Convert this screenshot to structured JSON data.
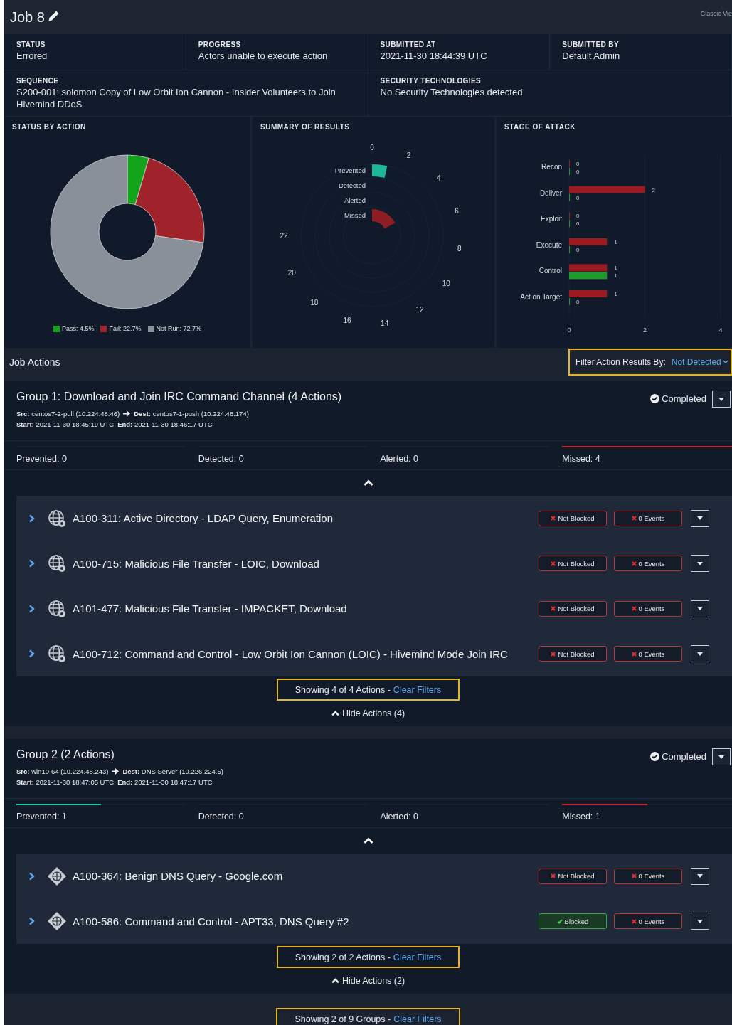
{
  "header": {
    "title": "Job 8",
    "view_link": "Classic Vie"
  },
  "info_rows": [
    [
      {
        "label": "STATUS",
        "value": "Errored"
      },
      {
        "label": "PROGRESS",
        "value": "Actors unable to execute action"
      },
      {
        "label": "SUBMITTED AT",
        "value": "2021-11-30 18:44:39 UTC"
      },
      {
        "label": "SUBMITTED BY",
        "value": "Default Admin"
      }
    ],
    [
      {
        "label": "SEQUENCE",
        "value": "S200-001: solomon Copy of Low Orbit Ion Cannon - Insider Volunteers to Join Hivemind DDoS"
      },
      {
        "label": "SECURITY TECHNOLOGIES",
        "value": "No Security Technologies detected"
      }
    ]
  ],
  "status_by_action": {
    "title": "STATUS BY ACTION",
    "chart_data": {
      "type": "donut",
      "categories": [
        "Pass: 4.5%",
        "Fail: 22.7%",
        "Not Run: 72.7%"
      ],
      "values": [
        4.5,
        22.7,
        72.7
      ],
      "colors": [
        "#14a41c",
        "#a0222a",
        "#8a9099"
      ],
      "legend": "bottom"
    }
  },
  "summary_of_results": {
    "title": "SUMMARY OF RESULTS",
    "scale_labels": [
      "0",
      "2",
      "4",
      "6",
      "8",
      "10",
      "12",
      "14",
      "16",
      "18",
      "20",
      "22"
    ],
    "rings": [
      {
        "label": "Prevented",
        "color": "#1fb597"
      },
      {
        "label": "Detected"
      },
      {
        "label": "Alerted"
      },
      {
        "label": "Missed",
        "color": "#8c1e24"
      }
    ]
  },
  "stage_of_attack": {
    "title": "STAGE OF ATTACK",
    "chart_data": {
      "type": "bar",
      "orientation": "horizontal",
      "categories": [
        "Recon",
        "Deliver",
        "Exploit",
        "Execute",
        "Control",
        "Act on Target"
      ],
      "series": [
        {
          "color": "#9b1b20",
          "values": [
            0,
            2,
            0,
            1,
            1,
            1
          ]
        },
        {
          "color": "#1f9a2a",
          "values": [
            0,
            0,
            0,
            0,
            1,
            0
          ]
        }
      ],
      "xlim": [
        0,
        4
      ],
      "xticks": [
        0,
        2,
        4
      ],
      "data_labels": true
    }
  },
  "job_actions": {
    "title": "Job Actions",
    "filter": {
      "label": "Filter Action Results By:",
      "value": "Not Detected"
    }
  },
  "groups": [
    {
      "title": "Group 1: Download and Join IRC Command Channel (4 Actions)",
      "status": "Completed",
      "src_label": "Src:",
      "src": "centos7-2-pull (10.224.48.46)",
      "dest_label": "Dest:",
      "dest": "centos7-1-push (10.224.48.174)",
      "start_label": "Start:",
      "start": "2021-11-30 18:45:19 UTC",
      "end_label": "End:",
      "end": "2021-11-30 18:46:17 UTC",
      "stats": [
        {
          "label": "Prevented: 0"
        },
        {
          "label": "Detected: 0"
        },
        {
          "label": "Alerted: 0"
        },
        {
          "label": "Missed: 4",
          "level": 1,
          "color": "#c0262b"
        }
      ],
      "actions": [
        {
          "kind": "globe",
          "title": "A100-311: Active Directory - LDAP Query, Enumeration",
          "blocked": false,
          "blocked_label": "Not Blocked",
          "events": "0 Events"
        },
        {
          "kind": "globe",
          "title": "A100-715: Malicious File Transfer - LOIC, Download",
          "blocked": false,
          "blocked_label": "Not Blocked",
          "events": "0 Events"
        },
        {
          "kind": "globe",
          "title": "A101-477: Malicious File Transfer - IMPACKET, Download",
          "blocked": false,
          "blocked_label": "Not Blocked",
          "events": "0 Events"
        },
        {
          "kind": "globe",
          "title": "A100-712: Command and Control - Low Orbit Ion Cannon (LOIC) - Hivemind Mode Join IRC",
          "blocked": false,
          "blocked_label": "Not Blocked",
          "events": "0 Events"
        }
      ],
      "showing": "Showing 4 of 4 Actions -",
      "clear": "Clear Filters",
      "hide": "Hide Actions (4)"
    },
    {
      "title": "Group 2 (2 Actions)",
      "status": "Completed",
      "src_label": "Src:",
      "src": "win10-64 (10.224.48.243)",
      "dest_label": "Dest:",
      "dest": "DNS Server (10.226.224.5)",
      "start_label": "Start:",
      "start": "2021-11-30 18:47:05 UTC",
      "end_label": "End:",
      "end": "2021-11-30 18:47:17 UTC",
      "stats": [
        {
          "label": "Prevented: 1",
          "level": 0.5,
          "color": "#1fc9a8"
        },
        {
          "label": "Detected: 0"
        },
        {
          "label": "Alerted: 0"
        },
        {
          "label": "Missed: 1",
          "level": 0.5,
          "color": "#c0262b"
        }
      ],
      "actions": [
        {
          "kind": "dns",
          "title": "A100-364: Benign DNS Query - Google.com",
          "blocked": false,
          "blocked_label": "Not Blocked",
          "events": "0 Events"
        },
        {
          "kind": "dns",
          "title": "A100-586: Command and Control - APT33, DNS Query #2",
          "blocked": true,
          "blocked_label": "Blocked",
          "events": "0 Events"
        }
      ],
      "showing": "Showing 2 of 2 Actions -",
      "clear": "Clear Filters",
      "hide": "Hide Actions (2)"
    }
  ],
  "footer": {
    "showing": "Showing 2 of 9 Groups -",
    "clear": "Clear Filters"
  }
}
